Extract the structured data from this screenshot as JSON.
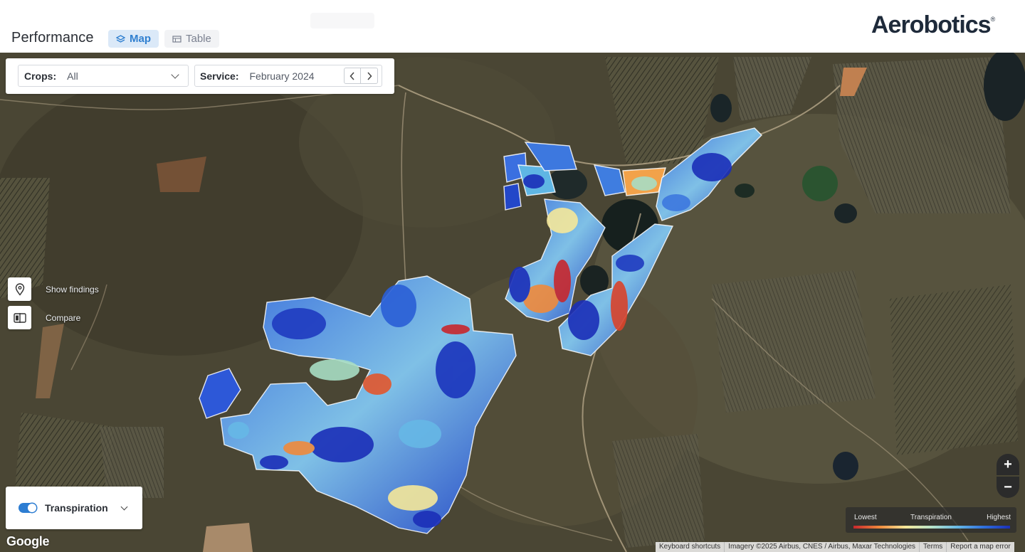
{
  "header": {
    "title": "Performance",
    "tabs": [
      {
        "label": "Map",
        "active": true
      },
      {
        "label": "Table",
        "active": false
      }
    ],
    "brand": {
      "name": "Aerobotics",
      "mark": "®"
    }
  },
  "filters": {
    "crops": {
      "label": "Crops:",
      "value": "All"
    },
    "service": {
      "label": "Service:",
      "value": "February 2024"
    }
  },
  "map_tools": [
    {
      "label": "Show findings",
      "icon": "map-pin-icon"
    },
    {
      "label": "Compare",
      "icon": "compare-icon"
    }
  ],
  "layer": {
    "label": "Transpiration",
    "enabled": true
  },
  "legend": {
    "low": "Lowest",
    "title": "Transpiration",
    "high": "Highest",
    "colors": [
      "#c8272d",
      "#f08a3c",
      "#f5e89a",
      "#b8e3c8",
      "#66b8e6",
      "#2f6fdc",
      "#1b2fb8"
    ]
  },
  "zoom": {
    "in": "+",
    "out": "−"
  },
  "google": "Google",
  "attribution": [
    "Keyboard shortcuts",
    "Imagery ©2025 Airbus, CNES / Airbus, Maxar Technologies",
    "Terms",
    "Report a map error"
  ]
}
